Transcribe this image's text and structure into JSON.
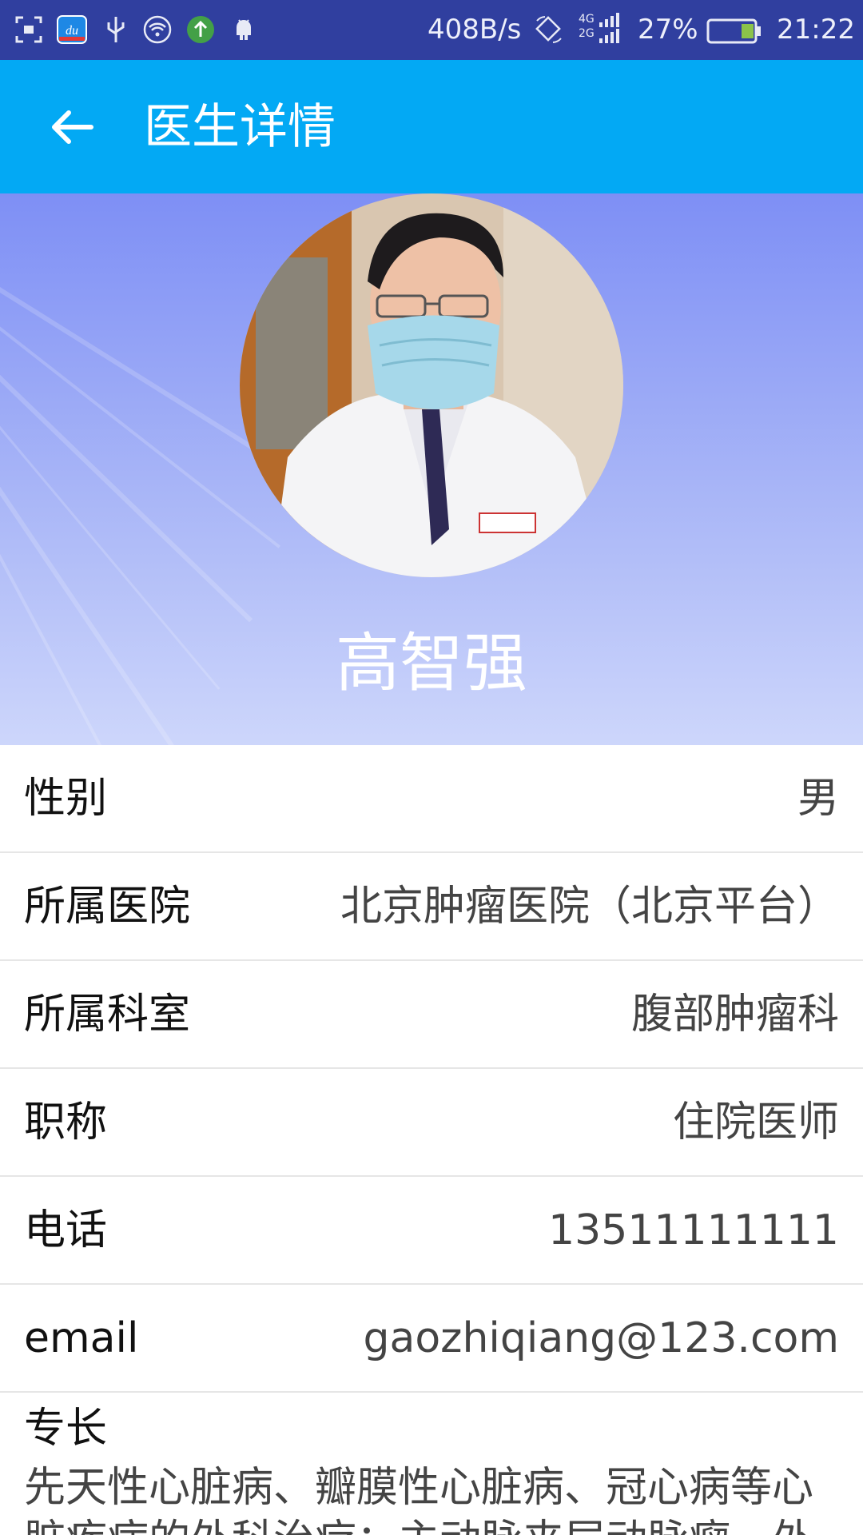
{
  "status_bar": {
    "network_speed": "408B/s",
    "network_type_top": "4G",
    "network_type_bottom": "2G",
    "battery_percent": "27%",
    "battery_level": 0.27,
    "time": "21:22",
    "icons": [
      "screenshot-icon",
      "du-app-icon",
      "usb-icon",
      "wifi-icon",
      "upload-icon",
      "android-icon",
      "rotate-icon",
      "signal-icon",
      "battery-icon"
    ]
  },
  "app_bar": {
    "title": "医生详情",
    "background_color": "#03a9f4"
  },
  "doctor": {
    "name": "高智强",
    "avatar": "doctor-photo"
  },
  "info": {
    "rows": [
      {
        "label": "性别",
        "value": "男"
      },
      {
        "label": "所属医院",
        "value": "北京肿瘤医院（北京平台）"
      },
      {
        "label": "所属科室",
        "value": "腹部肿瘤科"
      },
      {
        "label": "职称",
        "value": "住院医师"
      },
      {
        "label": "电话",
        "value": "13511111111"
      },
      {
        "label": "email",
        "value": "gaozhiqiang@123.com"
      }
    ]
  },
  "specialty": {
    "label": "专长",
    "text": "先天性心脏病、瓣膜性心脏病、冠心病等心脏疾病的外科治疗；主动脉夹层动脉瘤、外"
  },
  "colors": {
    "status_bar": "#303f9f",
    "hero_top": "#7e8ff5",
    "hero_bottom": "#cdd6fb"
  }
}
